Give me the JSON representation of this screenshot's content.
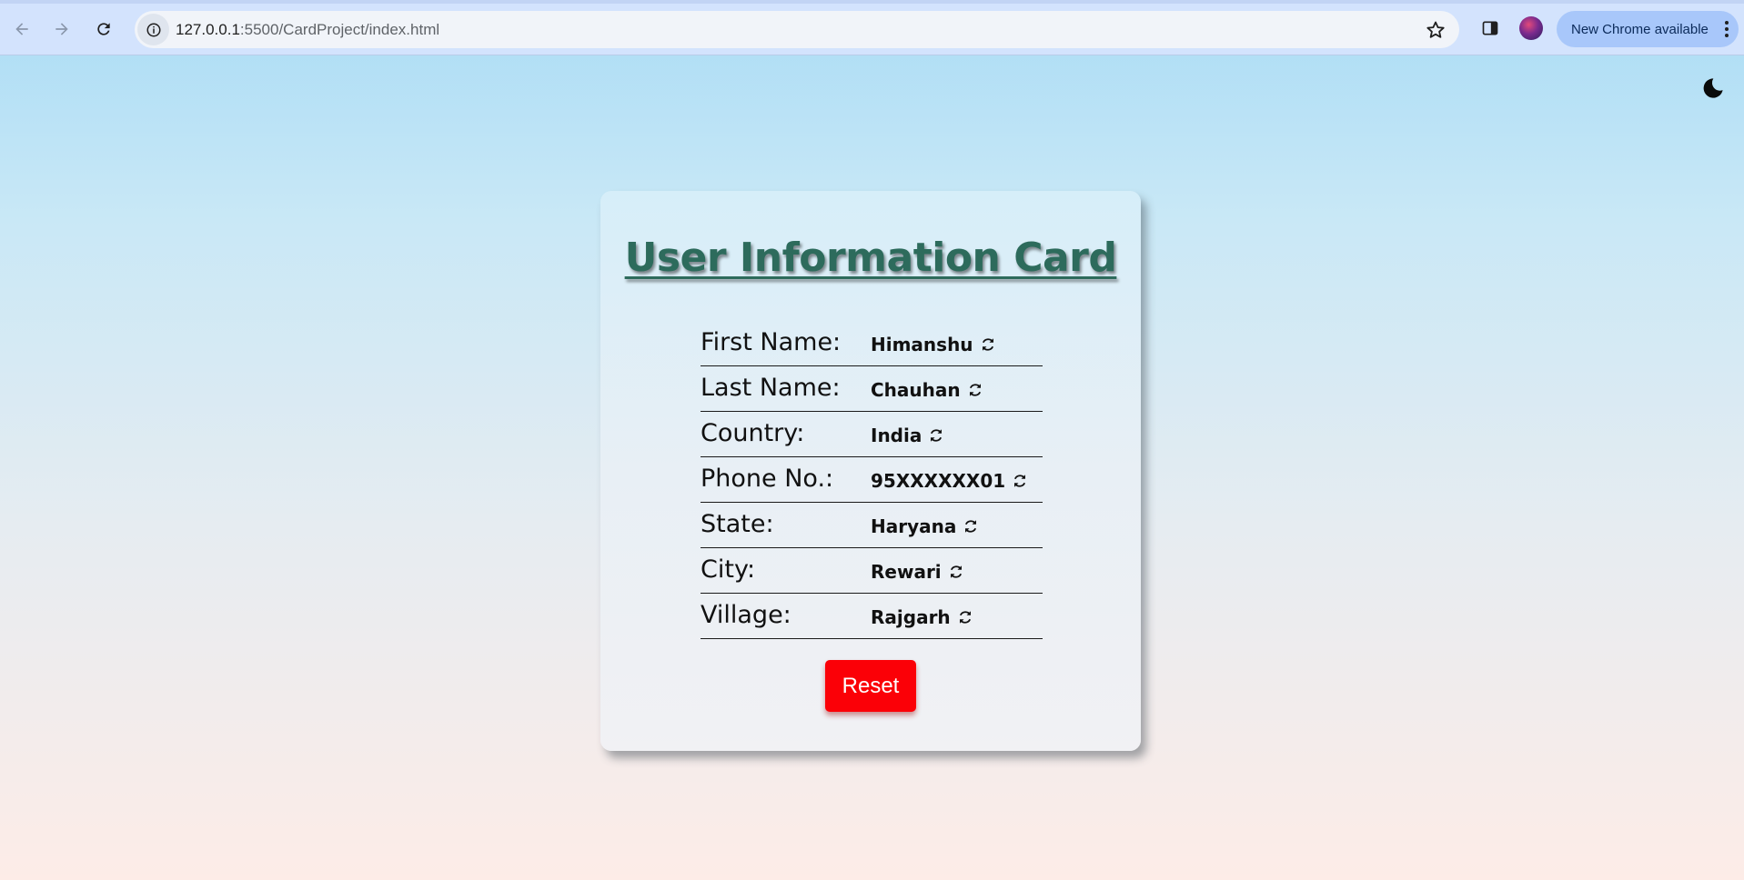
{
  "browser": {
    "url_host": "127.0.0.1",
    "url_rest": ":5500/CardProject/index.html",
    "update_label": "New Chrome available"
  },
  "card": {
    "title": "User Information Card",
    "fields": [
      {
        "label": "First Name:",
        "value": "Himanshu"
      },
      {
        "label": "Last Name:",
        "value": "Chauhan"
      },
      {
        "label": "Country:",
        "value": "India"
      },
      {
        "label": "Phone No.:",
        "value": "95XXXXXX01"
      },
      {
        "label": "State:",
        "value": "Haryana"
      },
      {
        "label": "City:",
        "value": "Rewari"
      },
      {
        "label": "Village:",
        "value": "Rajgarh"
      }
    ],
    "reset_label": "Reset"
  },
  "colors": {
    "title": "#2d6b5c",
    "reset_button": "#fb0007",
    "update_pill": "#a8c7fa"
  },
  "icons": {
    "theme_toggle": "moon-icon",
    "field_action": "refresh-icon"
  }
}
